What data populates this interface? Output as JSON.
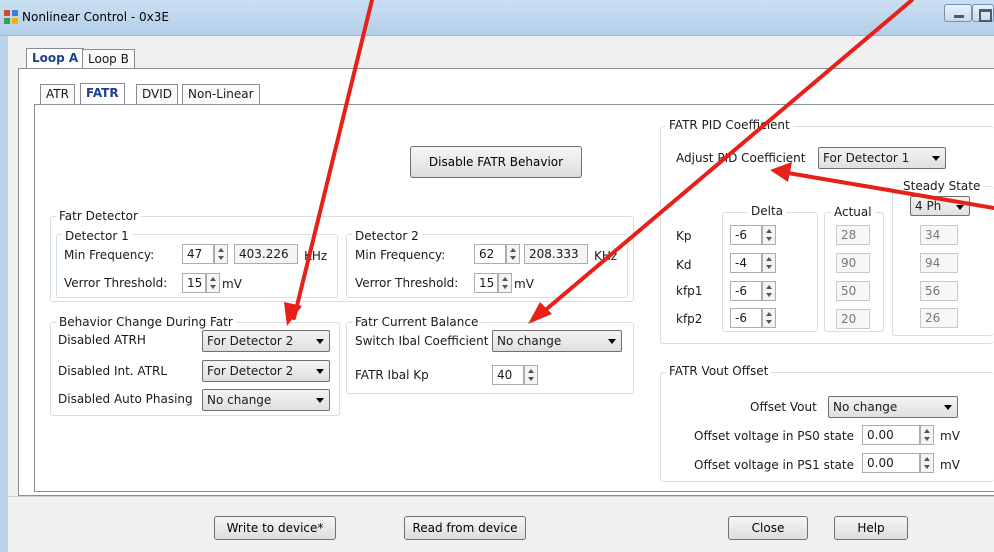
{
  "window": {
    "title": "Nonlinear Control - 0x3E"
  },
  "loop_tabs": [
    "Loop A",
    "Loop B"
  ],
  "sub_tabs": [
    "ATR",
    "FATR",
    "DVID",
    "Non-Linear"
  ],
  "disable_button": "Disable FATR Behavior",
  "fatr_detector": {
    "legend": "Fatr Detector",
    "detector1": {
      "title": "Detector 1",
      "min_freq_label": "Min Frequency:",
      "min_freq_value": "47",
      "freq_readout": "403.226",
      "unit": "KHz",
      "verror_label": "Verror Threshold:",
      "verror_value": "15",
      "verror_unit": "mV"
    },
    "detector2": {
      "title": "Detector 2",
      "min_freq_label": "Min Frequency:",
      "min_freq_value": "62",
      "freq_readout": "208.333",
      "unit": "KHz",
      "verror_label": "Verror Threshold:",
      "verror_value": "15",
      "verror_unit": "mV"
    }
  },
  "behavior": {
    "legend": "Behavior Change During Fatr",
    "rows": [
      {
        "label": "Disabled ATRH",
        "value": "For Detector 2"
      },
      {
        "label": "Disabled Int. ATRL",
        "value": "For Detector 2"
      },
      {
        "label": "Disabled Auto Phasing",
        "value": "No change"
      }
    ]
  },
  "current_balance": {
    "legend": "Fatr Current Balance",
    "switch_label": "Switch Ibal Coefficient",
    "switch_value": "No change",
    "kp_label": "FATR Ibal Kp",
    "kp_value": "40"
  },
  "pid": {
    "legend": "FATR PID Coefficient",
    "adjust_label": "Adjust PID Coefficient",
    "adjust_value": "For Detector 1",
    "steady_state_label": "Steady State",
    "steady_state_value": "4 Ph",
    "delta_label": "Delta",
    "actual_label": "Actual",
    "rows": [
      {
        "name": "Kp",
        "delta": "-6",
        "actual": "28",
        "steady": "34"
      },
      {
        "name": "Kd",
        "delta": "-4",
        "actual": "90",
        "steady": "94"
      },
      {
        "name": "kfp1",
        "delta": "-6",
        "actual": "50",
        "steady": "56"
      },
      {
        "name": "kfp2",
        "delta": "-6",
        "actual": "20",
        "steady": "26"
      }
    ]
  },
  "vout": {
    "legend": "FATR Vout Offset",
    "offset_label": "Offset Vout",
    "offset_value": "No change",
    "ps0_label": "Offset voltage in PS0 state",
    "ps0_value": "0.00",
    "ps1_label": "Offset voltage in PS1 state",
    "ps1_value": "0.00",
    "unit": "mV"
  },
  "buttons": {
    "write": "Write to device*",
    "read": "Read from device",
    "close": "Close",
    "help": "Help"
  },
  "colors": {
    "annotation_arrow": "#e8201a",
    "active_tab": "#1c3f94"
  }
}
